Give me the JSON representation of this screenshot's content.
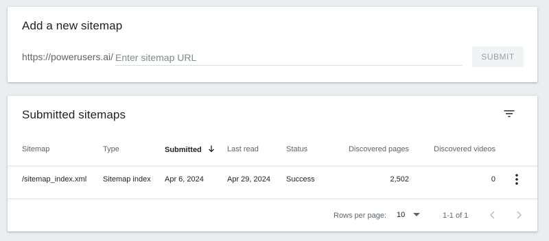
{
  "add_sitemap": {
    "title": "Add a new sitemap",
    "url_prefix": "https://powerusers.ai/",
    "input_value": "",
    "input_placeholder": "Enter sitemap URL",
    "submit_label": "SUBMIT"
  },
  "submitted_sitemaps": {
    "title": "Submitted sitemaps",
    "filter_icon": "filter-list-icon",
    "columns": [
      "Sitemap",
      "Type",
      "Submitted",
      "Last read",
      "Status",
      "Discovered pages",
      "Discovered videos"
    ],
    "sorted_column": "Submitted",
    "sort_direction": "descending",
    "rows": [
      {
        "sitemap": "/sitemap_index.xml",
        "type": "Sitemap index",
        "submitted": "Apr 6, 2024",
        "last_read": "Apr 29, 2024",
        "status": "Success",
        "discovered_pages": "2,502",
        "discovered_videos": "0"
      }
    ],
    "pagination": {
      "rows_per_page_label": "Rows per page:",
      "rows_per_page_value": "10",
      "range": "1-1 of 1"
    }
  },
  "colors": {
    "background": "#ebedf0",
    "card": "#ffffff",
    "text_primary": "#202124",
    "text_secondary": "#5f6368",
    "button_disabled_bg": "#f1f3f4",
    "button_disabled_text": "#9aa0a6"
  }
}
